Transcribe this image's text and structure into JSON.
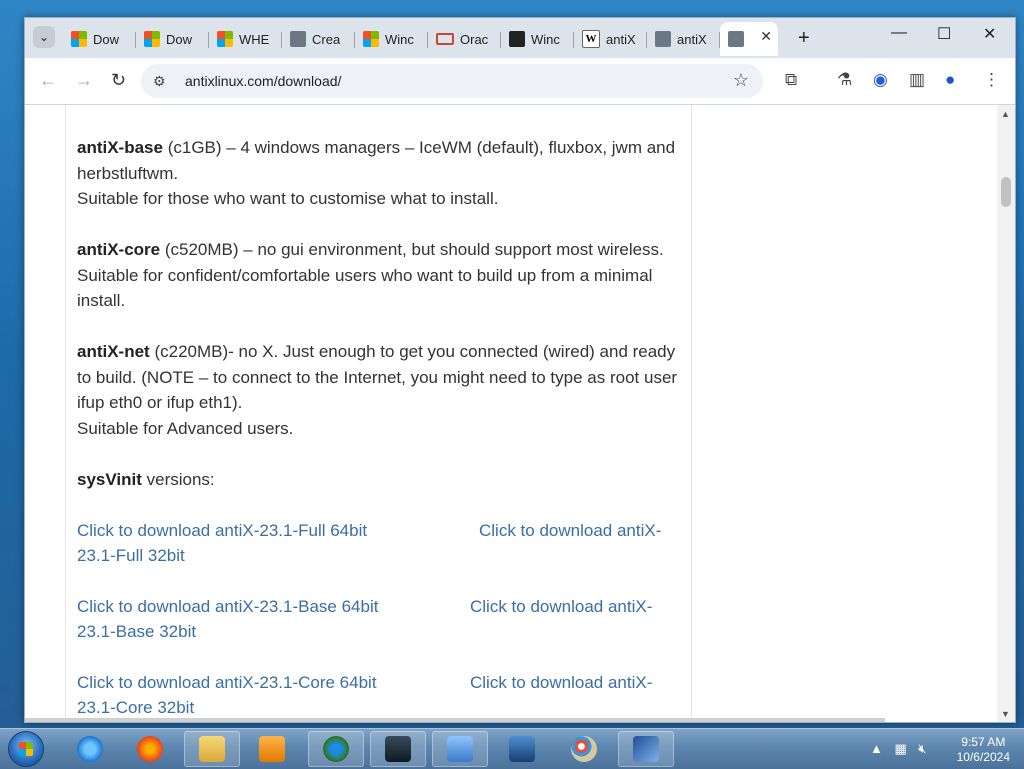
{
  "browser": {
    "tabs": [
      {
        "label": "Dow",
        "favicon": "windows-logo"
      },
      {
        "label": "Dow",
        "favicon": "windows-logo"
      },
      {
        "label": "WHE",
        "favicon": "windows-logo"
      },
      {
        "label": "Crea",
        "favicon": "globe"
      },
      {
        "label": "Winc",
        "favicon": "windows-logo"
      },
      {
        "label": "Orac",
        "favicon": "oracle-logo"
      },
      {
        "label": "Winc",
        "favicon": "virtualbox-logo"
      },
      {
        "label": "antiX",
        "favicon": "wikipedia-logo"
      },
      {
        "label": "antiX",
        "favicon": "globe"
      },
      {
        "label": "",
        "favicon": "globe",
        "active": true
      }
    ],
    "url_domain": "antixlinux.com",
    "url_path": "/download/",
    "url": "antixlinux.com/download/"
  },
  "page": {
    "paragraphs": [
      {
        "bold": "antiX-base",
        "text": " (c1GB) – 4 windows managers – IceWM (default), fluxbox, jwm and herbstluftwm.",
        "line2": "Suitable for those who want to customise what to install."
      },
      {
        "bold": "antiX-core",
        "text": " (c520MB) – no gui environment, but should support most wireless.",
        "line2": "Suitable for confident/comfortable users who want to build up from a minimal install."
      },
      {
        "bold": "antiX-net",
        "text": " (c220MB)- no X. Just enough to get you connected (wired) and ready to build. (NOTE – to connect to the Internet, you might need to type as root user ifup eth0 or ifup eth1).",
        "line2": "Suitable for Advanced users."
      },
      {
        "bold": "sysVinit",
        "text": " versions:",
        "line2": ""
      }
    ],
    "downloads": [
      {
        "left": "Click to download antiX-23.1-Full 64bit",
        "right_start": "Click to download antiX-",
        "right_end": "23.1-Full 32bit"
      },
      {
        "left": "Click to download antiX-23.1-Base 64bit",
        "right_start": "Click to download antiX-",
        "right_end": "23.1-Base 32bit"
      },
      {
        "left": "Click to download antiX-23.1-Core 64bit",
        "right_start": "Click to download antiX-",
        "right_end": "23.1-Core 32bit"
      }
    ]
  },
  "taskbar": {
    "apps": [
      "internet-explorer",
      "firefox",
      "file-explorer",
      "media-player",
      "chrome",
      "terminal",
      "remote-desktop",
      "virtualbox",
      "paint",
      "xp-mode"
    ],
    "time": "9:57 AM",
    "date": "10/6/2024"
  },
  "colors": {
    "link": "#3a6ea5",
    "text": "#333333",
    "tabstrip": "#dde3ea"
  }
}
